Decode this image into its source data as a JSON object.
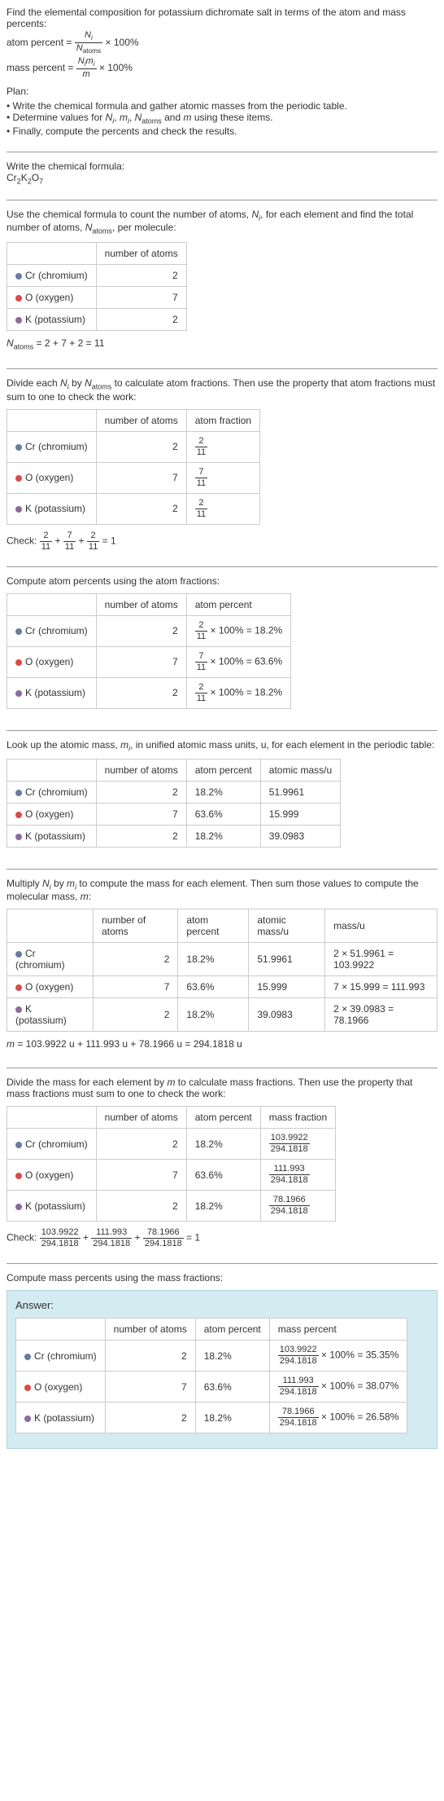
{
  "intro": {
    "line1": "Find the elemental composition for potassium dichromate salt in terms of the atom and mass percents:",
    "atom_percent_label": "atom percent",
    "mass_percent_label": "mass percent",
    "times100": " × 100%"
  },
  "plan": {
    "header": "Plan:",
    "b1": "• Write the chemical formula and gather atomic masses from the periodic table.",
    "b2": "• Determine values for ",
    "b2_suffix": " using these items.",
    "b3": "• Finally, compute the percents and check the results."
  },
  "formula_section": {
    "title": "Write the chemical formula:",
    "formula": "Cr₂K₂O₇"
  },
  "count_section": {
    "text1": "Use the chemical formula to count the number of atoms, ",
    "text2": ", for each element and find the total number of atoms, ",
    "text3": ", per molecule:",
    "col_atoms": "number of atoms",
    "cr_label": "Cr (chromium)",
    "o_label": "O (oxygen)",
    "k_label": "K (potassium)",
    "cr_n": "2",
    "o_n": "7",
    "k_n": "2",
    "natoms_eq": " = 2 + 7 + 2 = 11"
  },
  "atomfrac_section": {
    "text": "Divide each ",
    "text2": " by ",
    "text3": " to calculate atom fractions. Then use the property that atom fractions must sum to one to check the work:",
    "col_atoms": "number of atoms",
    "col_frac": "atom fraction",
    "cr_n": "2",
    "o_n": "7",
    "k_n": "2",
    "check": "Check: ",
    "check_eq": " = 1"
  },
  "atompercent_section": {
    "text": "Compute atom percents using the atom fractions:",
    "col_atoms": "number of atoms",
    "col_pct": "atom percent",
    "cr_n": "2",
    "o_n": "7",
    "k_n": "2",
    "cr_pct": " × 100% = 18.2%",
    "o_pct": " × 100% = 63.6%",
    "k_pct": " × 100% = 18.2%"
  },
  "atomicmass_section": {
    "text1": "Look up the atomic mass, ",
    "text2": ", in unified atomic mass units, u, for each element in the periodic table:",
    "col_atoms": "number of atoms",
    "col_pct": "atom percent",
    "col_mass": "atomic mass/u",
    "cr_n": "2",
    "cr_pct": "18.2%",
    "cr_mass": "51.9961",
    "o_n": "7",
    "o_pct": "63.6%",
    "o_mass": "15.999",
    "k_n": "2",
    "k_pct": "18.2%",
    "k_mass": "39.0983"
  },
  "molmass_section": {
    "text1": "Multiply ",
    "text2": " by ",
    "text3": " to compute the mass for each element. Then sum those values to compute the molecular mass, ",
    "text4": ":",
    "col_atoms": "number of atoms",
    "col_pct": "atom percent",
    "col_amass": "atomic mass/u",
    "col_massu": "mass/u",
    "cr_n": "2",
    "cr_pct": "18.2%",
    "cr_amass": "51.9961",
    "cr_mass": "2 × 51.9961 = 103.9922",
    "o_n": "7",
    "o_pct": "63.6%",
    "o_amass": "15.999",
    "o_mass": "7 × 15.999 = 111.993",
    "k_n": "2",
    "k_pct": "18.2%",
    "k_amass": "39.0983",
    "k_mass": "2 × 39.0983 = 78.1966",
    "m_eq": " = 103.9922 u + 111.993 u + 78.1966 u = 294.1818 u"
  },
  "massfrac_section": {
    "text1": "Divide the mass for each element by ",
    "text2": " to calculate mass fractions. Then use the property that mass fractions must sum to one to check the work:",
    "col_atoms": "number of atoms",
    "col_pct": "atom percent",
    "col_mfrac": "mass fraction",
    "cr_n": "2",
    "cr_pct": "18.2%",
    "o_n": "7",
    "o_pct": "63.6%",
    "k_n": "2",
    "k_pct": "18.2%",
    "cr_num": "103.9922",
    "o_num": "111.993",
    "k_num": "78.1966",
    "den": "294.1818",
    "check": "Check: ",
    "check_eq": " = 1"
  },
  "final_section": {
    "text": "Compute mass percents using the mass fractions:",
    "answer": "Answer:",
    "col_atoms": "number of atoms",
    "col_pct": "atom percent",
    "col_mpct": "mass percent",
    "cr_n": "2",
    "cr_pct": "18.2%",
    "o_n": "7",
    "o_pct": "63.6%",
    "k_n": "2",
    "k_pct": "18.2%",
    "cr_num": "103.9922",
    "o_num": "111.993",
    "k_num": "78.1966",
    "den": "294.1818",
    "times": " × 100% = ",
    "cr_res": "35.35%",
    "o_res": "38.07%",
    "k_res": "26.58%"
  },
  "elements": {
    "cr": "Cr (chromium)",
    "o": "O (oxygen)",
    "k": "K (potassium)"
  },
  "chart_data": {
    "type": "table",
    "title": "Elemental composition of potassium dichromate (Cr2K2O7)",
    "elements": [
      {
        "symbol": "Cr",
        "name": "chromium",
        "atoms": 2,
        "atom_fraction": "2/11",
        "atom_percent": 18.2,
        "atomic_mass_u": 51.9961,
        "mass_u": 103.9922,
        "mass_fraction": "103.9922/294.1818",
        "mass_percent": 35.35
      },
      {
        "symbol": "O",
        "name": "oxygen",
        "atoms": 7,
        "atom_fraction": "7/11",
        "atom_percent": 63.6,
        "atomic_mass_u": 15.999,
        "mass_u": 111.993,
        "mass_fraction": "111.993/294.1818",
        "mass_percent": 38.07
      },
      {
        "symbol": "K",
        "name": "potassium",
        "atoms": 2,
        "atom_fraction": "2/11",
        "atom_percent": 18.2,
        "atomic_mass_u": 39.0983,
        "mass_u": 78.1966,
        "mass_fraction": "78.1966/294.1818",
        "mass_percent": 26.58
      }
    ],
    "N_atoms": 11,
    "molecular_mass_u": 294.1818
  }
}
